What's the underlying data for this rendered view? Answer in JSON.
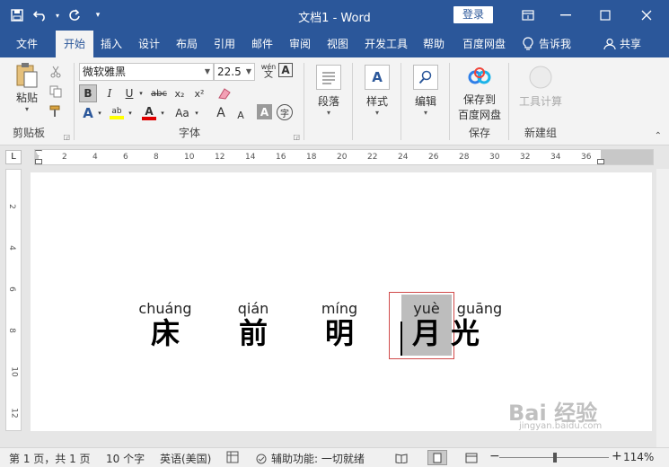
{
  "titlebar": {
    "title": "文档1  -  Word",
    "login_label": "登录",
    "qat": [
      "save-icon",
      "undo-icon",
      "redo-icon",
      "customize-qat-icon"
    ]
  },
  "tabs": [
    {
      "label": "文件"
    },
    {
      "label": "开始"
    },
    {
      "label": "插入"
    },
    {
      "label": "设计"
    },
    {
      "label": "布局"
    },
    {
      "label": "引用"
    },
    {
      "label": "邮件"
    },
    {
      "label": "审阅"
    },
    {
      "label": "视图"
    },
    {
      "label": "开发工具"
    },
    {
      "label": "帮助"
    },
    {
      "label": "百度网盘"
    },
    {
      "label": "告诉我"
    },
    {
      "label": "共享"
    }
  ],
  "ribbon": {
    "clipboard": {
      "paste_label": "粘贴",
      "group_label": "剪贴板"
    },
    "font": {
      "font_name": "微软雅黑",
      "font_size": "22.5",
      "group_label": "字体",
      "bold": "B",
      "italic": "I",
      "underline": "U",
      "strike": "abc",
      "subscript": "x₂",
      "superscript": "x²",
      "grow": "A",
      "shrink": "A",
      "case": "Aa",
      "char_shade": "A",
      "enclose": "字",
      "phonetic": "wén",
      "phonetic_a": "A"
    },
    "paragraph": {
      "label": "段落"
    },
    "styles": {
      "label": "样式"
    },
    "editing": {
      "label": "编辑"
    },
    "save": {
      "label_line1": "保存到",
      "label_line2": "百度网盘",
      "group_label": "保存"
    },
    "newgroup": {
      "label": "工具计算",
      "group_label": "新建组"
    }
  },
  "ruler": {
    "corner": "L",
    "ticks": [
      "2",
      "4",
      "6",
      "8",
      "10",
      "12",
      "14",
      "16",
      "18",
      "20",
      "22",
      "24",
      "26",
      "28",
      "30",
      "32",
      "34",
      "36"
    ],
    "vticks": [
      "2",
      "4",
      "6",
      "8",
      "10",
      "12"
    ]
  },
  "document": {
    "chars": [
      {
        "pinyin": "chuáng",
        "hanzi": "床"
      },
      {
        "pinyin": "qián",
        "hanzi": "前"
      },
      {
        "pinyin": "míng",
        "hanzi": "明"
      },
      {
        "pinyin": "yuè",
        "hanzi": "月"
      },
      {
        "pinyin": "guāng",
        "hanzi": "光"
      }
    ]
  },
  "statusbar": {
    "page": "第 1 页，共 1 页",
    "words": "10 个字",
    "language": "英语(美国)",
    "accessibility": "辅助功能: 一切就绪",
    "zoom": "114%",
    "minus": "−",
    "plus": "+"
  },
  "watermark": {
    "text": "Bai 经验",
    "sub": "jingyan.baidu.com"
  }
}
